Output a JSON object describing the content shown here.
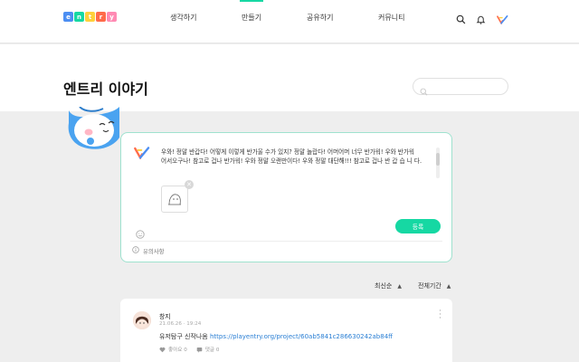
{
  "brand": {
    "logo_letters": [
      "e",
      "n",
      "t",
      "r",
      "y"
    ],
    "logo_colors": [
      "#4c8ef2",
      "#16d8a3",
      "#ffd03c",
      "#ff6b4a",
      "#ff8ab3"
    ],
    "accent": "#16d8a3"
  },
  "nav": {
    "items": [
      {
        "label": "생각하기"
      },
      {
        "label": "만들기"
      },
      {
        "label": "공유하기"
      },
      {
        "label": "커뮤니티"
      }
    ],
    "icons": [
      "search-icon",
      "bell-icon",
      "profile-logo-icon"
    ]
  },
  "page": {
    "title": "엔트리 이야기",
    "search_placeholder": ""
  },
  "composer": {
    "text": "우와! 정말 반갑다! 어떻게 이렇게 반가울 수가 있지? 정말 놀랍다! 어머어머 너무 반가워! 우와 반가워 어서오구나! 참고로 겁나 반가워! 우와 정말 오랜만이다! 우와 정말 대단해!!! 참고로 겁나 반 갑 습 니 다.",
    "submit_label": "등록",
    "notice_label": "유의사항"
  },
  "sort": {
    "order_label": "최신순",
    "period_label": "전체기간"
  },
  "post": {
    "author": "창지",
    "timestamp": "21.06.26 · 19:24",
    "text_prefix": "유저탐구 신작나옴 ",
    "link": "https://playentry.org/project/60ab5841c286630242ab84ff",
    "likes_label": "좋아요 0",
    "comments_label": "댓글 0"
  }
}
